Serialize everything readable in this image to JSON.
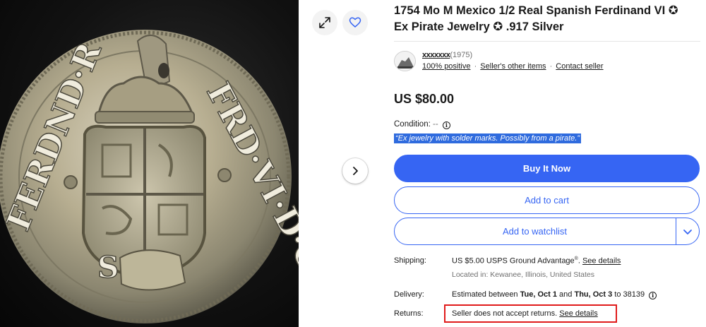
{
  "gallery": {
    "image_alt": "1754 Mexico 1/2 Real silver coin",
    "coin_legend_left": "FERDND·R",
    "coin_legend_right": "FRD·VI·D·G",
    "coin_mintmark": "S",
    "expand_icon": "expand-arrows-icon",
    "watch_icon": "heart-icon",
    "next_icon": "chevron-right-icon"
  },
  "listing": {
    "title_line1": "1754 Mo M Mexico 1/2 Real Spanish Ferdinand VI",
    "title_line2_a": "Ex Pirate Jewelry",
    "title_line2_b": ".917 Silver",
    "title_star": "✪"
  },
  "seller": {
    "name": "xxxxxxx",
    "feedback_count": "(1975)",
    "positive": "100% positive",
    "other_items": "Seller's other items",
    "contact": "Contact seller",
    "separator": "·"
  },
  "price": {
    "display": "US $80.00"
  },
  "condition": {
    "label": "Condition:",
    "value": "--",
    "note": "“Ex jewelry with solder marks. Possibly from a pirate.”"
  },
  "actions": {
    "buy_now": "Buy It Now",
    "add_to_cart": "Add to cart",
    "add_to_watchlist": "Add to watchlist"
  },
  "shipping": {
    "label": "Shipping:",
    "cost": "US $5.00 USPS Ground Advantage",
    "registered": "®",
    "period": ".",
    "see_details": "See details",
    "located": "Located in: Kewanee, Illinois, United States"
  },
  "delivery": {
    "label": "Delivery:",
    "prefix": "Estimated between ",
    "start": "Tue, Oct 1",
    "and": " and ",
    "end": "Thu, Oct 3",
    "to": " to 38139"
  },
  "returns": {
    "label": "Returns:",
    "text": "Seller does not accept returns.",
    "see_details": "See details"
  },
  "colors": {
    "accent_blue": "#3665f3",
    "highlight_red": "#e01b1b",
    "selection_blue": "#2f6bde"
  }
}
